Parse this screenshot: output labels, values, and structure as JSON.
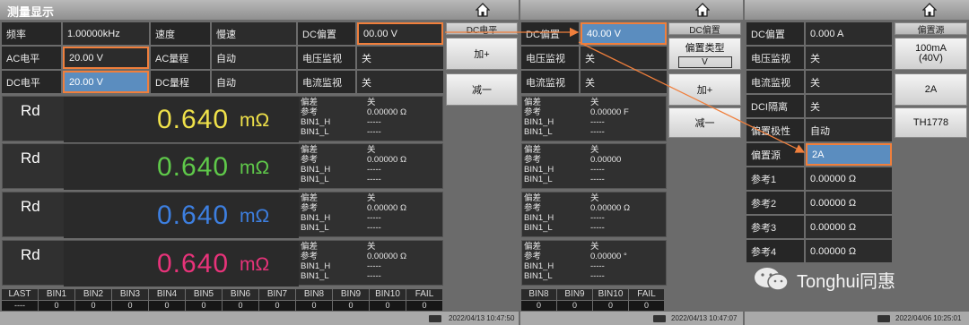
{
  "panel1": {
    "title": "测量显示",
    "rows": [
      {
        "l1": "频率",
        "v1": "1.00000kHz",
        "l2": "速度",
        "v2": "慢速",
        "l3": "DC偏置",
        "v3": "00.00 V"
      },
      {
        "l1": "AC电平",
        "v1": "20.00 V",
        "l2": "AC量程",
        "v2": "自动",
        "l3": "电压监视",
        "v3": "关"
      },
      {
        "l1": "DC电平",
        "v1": "20.00 V",
        "l2": "DC量程",
        "v2": "自动",
        "l3": "电流监视",
        "v3": "关"
      }
    ],
    "softkey_header": "DC电平",
    "softkeys": [
      "加+",
      "减一"
    ],
    "readouts": [
      {
        "label": "Rd",
        "value": "0.640",
        "unit": "mΩ",
        "color": "#f0e24a",
        "mini": [
          "偏差",
          "参考",
          "BIN1_H",
          "BIN1_L"
        ],
        "mini_vals": [
          "关",
          "0.00000 Ω",
          "-----",
          "-----"
        ]
      },
      {
        "label": "Rd",
        "value": "0.640",
        "unit": "mΩ",
        "color": "#5fc94a",
        "mini": [
          "偏差",
          "参考",
          "BIN1_H",
          "BIN1_L"
        ],
        "mini_vals": [
          "关",
          "0.00000 Ω",
          "-----",
          "-----"
        ]
      },
      {
        "label": "Rd",
        "value": "0.640",
        "unit": "mΩ",
        "color": "#3d7fe0",
        "mini": [
          "偏差",
          "参考",
          "BIN1_H",
          "BIN1_L"
        ],
        "mini_vals": [
          "关",
          "0.00000 Ω",
          "-----",
          "-----"
        ]
      },
      {
        "label": "Rd",
        "value": "0.640",
        "unit": "mΩ",
        "color": "#e8337a",
        "mini": [
          "偏差",
          "参考",
          "BIN1_H",
          "BIN1_L"
        ],
        "mini_vals": [
          "关",
          "0.00000 Ω",
          "-----",
          "-----"
        ]
      }
    ],
    "bins": [
      "LAST",
      "BIN1",
      "BIN2",
      "BIN3",
      "BIN4",
      "BIN5",
      "BIN6",
      "BIN7",
      "BIN8",
      "BIN9",
      "BIN10",
      "FAIL"
    ],
    "bin_vals": [
      "----",
      "0",
      "0",
      "0",
      "0",
      "0",
      "0",
      "0",
      "0",
      "0",
      "0",
      "0"
    ],
    "timestamp": "2022/04/13 10:47:50"
  },
  "panel2": {
    "rows": [
      {
        "l": "DC偏置",
        "v": "40.00 V"
      },
      {
        "l": "电压监视",
        "v": "关"
      },
      {
        "l": "电流监视",
        "v": "关"
      }
    ],
    "softkey_header": "DC偏置",
    "bias_type_label": "偏置类型",
    "bias_type_value": "V",
    "softkeys": [
      "加+",
      "减一"
    ],
    "minis": [
      {
        "labels": [
          "偏差",
          "参考",
          "BIN1_H",
          "BIN1_L"
        ],
        "vals": [
          "关",
          "0.00000 F",
          "-----",
          "-----"
        ]
      },
      {
        "labels": [
          "偏差",
          "参考",
          "BIN1_H",
          "BIN1_L"
        ],
        "vals": [
          "关",
          "0.00000",
          "-----",
          "-----"
        ]
      },
      {
        "labels": [
          "偏差",
          "参考",
          "BIN1_H",
          "BIN1_L"
        ],
        "vals": [
          "关",
          "0.00000 Ω",
          "-----",
          "-----"
        ]
      },
      {
        "labels": [
          "偏差",
          "参考",
          "BIN1_H",
          "BIN1_L"
        ],
        "vals": [
          "关",
          "0.00000 °",
          "-----",
          "-----"
        ]
      }
    ],
    "bins": [
      "BIN8",
      "BIN9",
      "BIN10",
      "FAIL"
    ],
    "bin_vals": [
      "0",
      "0",
      "0",
      "0"
    ],
    "timestamp": "2022/04/13 10:47:07"
  },
  "panel3": {
    "rows": [
      {
        "l": "DC偏置",
        "v": "0.000 A"
      },
      {
        "l": "电压监视",
        "v": "关"
      },
      {
        "l": "电流监视",
        "v": "关"
      },
      {
        "l": "DCI隔离",
        "v": "关"
      },
      {
        "l": "偏置极性",
        "v": "自动"
      },
      {
        "l": "偏置源",
        "v": "2A"
      },
      {
        "l": "参考1",
        "v": "0.00000 Ω"
      },
      {
        "l": "参考2",
        "v": "0.00000 Ω"
      },
      {
        "l": "参考3",
        "v": "0.00000 Ω"
      },
      {
        "l": "参考4",
        "v": "0.00000 Ω"
      }
    ],
    "softkey_header": "偏置源",
    "softkeys": [
      "100mA\n(40V)",
      "2A",
      "TH1778"
    ],
    "watermark": "Tonghui同惠",
    "timestamp": "2022/04/06 10:25:01"
  }
}
